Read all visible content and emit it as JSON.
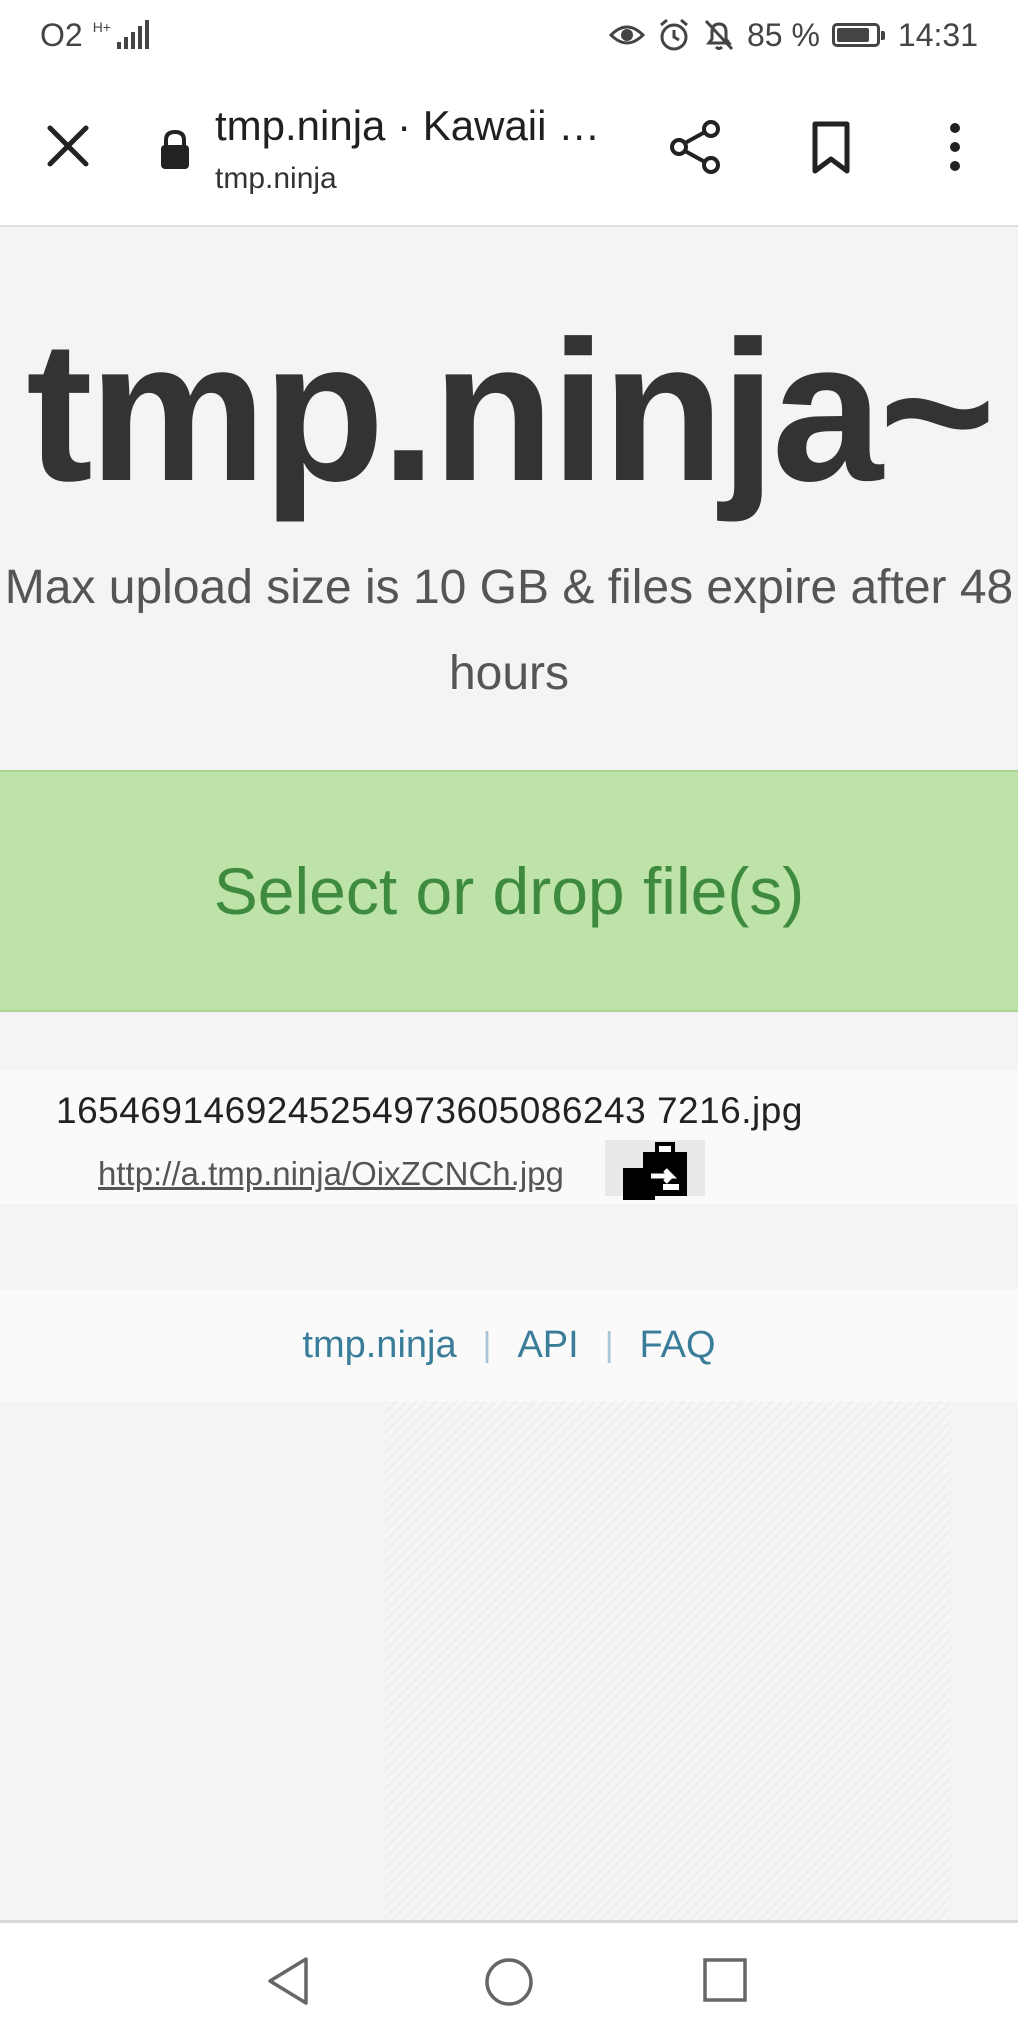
{
  "status_bar": {
    "carrier": "O2",
    "network_type": "H+",
    "battery_percent": "85 %",
    "battery_level": 0.85,
    "time": "14:31",
    "icons": [
      "signal-icon",
      "eye-icon",
      "alarm-icon",
      "bell-off-icon",
      "battery-icon"
    ]
  },
  "browser": {
    "page_title": "tmp.ninja · Kawaii File Hosting",
    "domain": "tmp.ninja",
    "icons": [
      "close-icon",
      "lock-icon",
      "share-icon",
      "bookmark-icon",
      "more-vert-icon"
    ]
  },
  "hero": {
    "title": "tmp.ninja~",
    "subtitle": "Max upload size is 10 GB & files expire after 48 hours"
  },
  "dropzone": {
    "label": "Select or drop file(s)",
    "color": "#bde3a9",
    "text_color": "#3e8a3e"
  },
  "uploads": [
    {
      "filename": "1654691469245254973605086243 7216.jpg",
      "url": "http://a.tmp.ninja/OixZCNCh.jpg",
      "action_icon": "copy-clipboard-icon"
    }
  ],
  "footer": {
    "links": [
      "tmp.ninja",
      "API",
      "FAQ"
    ],
    "separator": "|",
    "link_color": "#3a7d99"
  },
  "nav_bar": {
    "icons": [
      "back-icon",
      "home-icon",
      "recents-icon"
    ]
  }
}
